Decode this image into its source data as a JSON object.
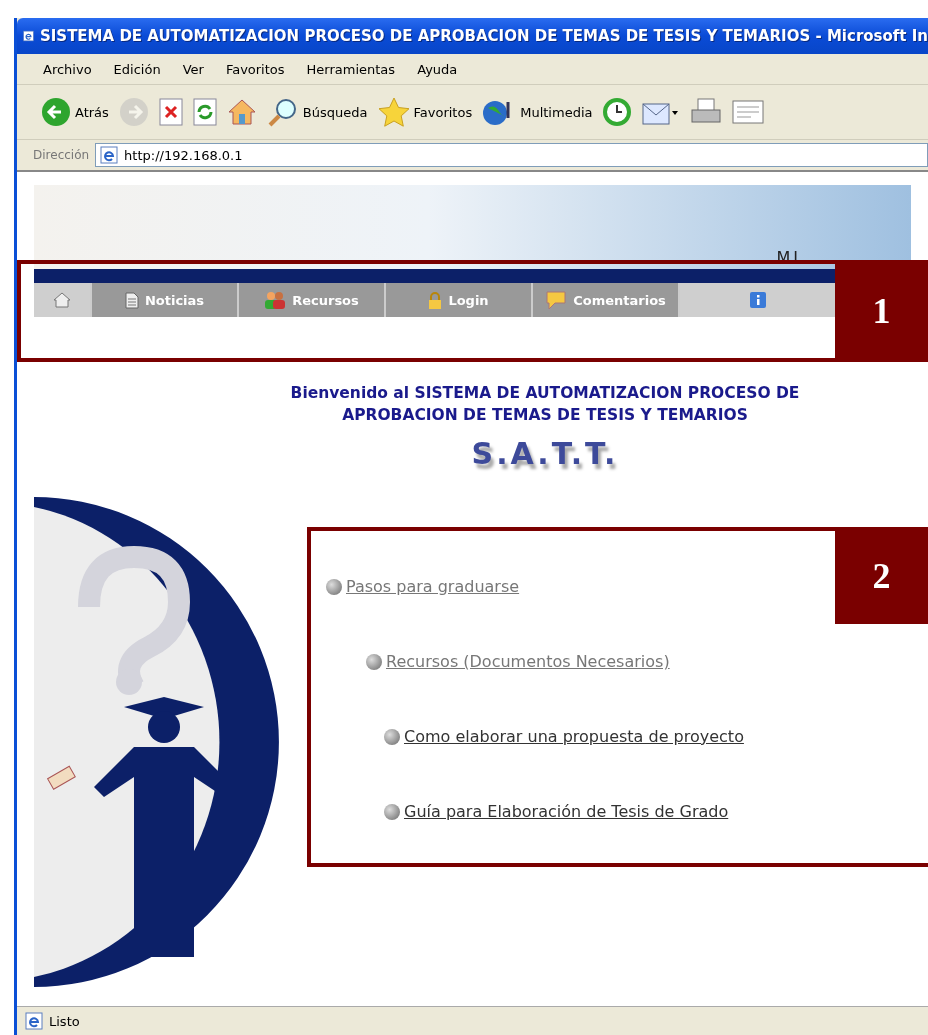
{
  "window": {
    "title": "SISTEMA DE AUTOMATIZACION PROCESO DE APROBACION DE TEMAS DE TESIS Y TEMARIOS - Microsoft In"
  },
  "menu": [
    "Archivo",
    "Edición",
    "Ver",
    "Favoritos",
    "Herramientas",
    "Ayuda"
  ],
  "toolbar": [
    {
      "kind": "back",
      "label": "Atrás",
      "disabled": false
    },
    {
      "kind": "forward",
      "disabled": true
    },
    {
      "kind": "stop",
      "disabled": false
    },
    {
      "kind": "refresh",
      "disabled": false
    },
    {
      "kind": "home",
      "disabled": false
    },
    {
      "kind": "search",
      "label": "Búsqueda",
      "disabled": false
    },
    {
      "kind": "favorites",
      "label": "Favoritos",
      "disabled": false
    },
    {
      "kind": "media",
      "label": "Multimedia",
      "disabled": false
    },
    {
      "kind": "history",
      "disabled": false
    },
    {
      "kind": "mail",
      "disabled": false
    },
    {
      "kind": "print",
      "disabled": false
    },
    {
      "kind": "edit",
      "disabled": false
    }
  ],
  "address": {
    "label": "Dirección",
    "value": "http://192.168.0.1"
  },
  "banner": {
    "text": "MI"
  },
  "nav": [
    {
      "kind": "home"
    },
    {
      "kind": "news",
      "label": "Noticias"
    },
    {
      "kind": "resources",
      "label": "Recursos"
    },
    {
      "kind": "login",
      "label": "Login"
    },
    {
      "kind": "comments",
      "label": "Comentarios"
    },
    {
      "kind": "info"
    }
  ],
  "welcome": {
    "lines": [
      "Bienvenido al SISTEMA DE AUTOMATIZACION PROCESO DE",
      "APROBACION DE TEMAS DE TESIS Y TEMARIOS"
    ],
    "logo": "S.A.T.T."
  },
  "links": [
    {
      "label": "Pasos para graduarse"
    },
    {
      "label": "Recursos (Documentos Necesarios)"
    },
    {
      "label": "Como elaborar una propuesta de proyecto"
    },
    {
      "label": "Guía para Elaboración de Tesis de Grado"
    }
  ],
  "callouts": [
    {
      "number": "1"
    },
    {
      "number": "2"
    }
  ],
  "status_bar": {
    "text": "Listo"
  }
}
